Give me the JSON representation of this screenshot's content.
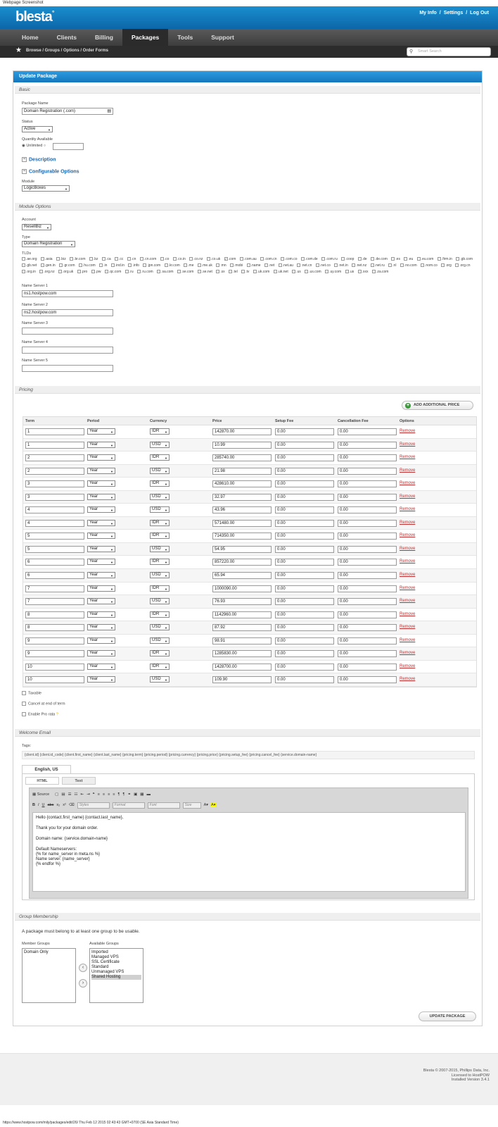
{
  "caption": "Webpage Screenshot",
  "brand": "blesta",
  "toplinks": {
    "my_info": "My Info",
    "sep1": "/",
    "settings": "Settings",
    "sep2": "/",
    "logout": "Log Out"
  },
  "nav": [
    "Home",
    "Clients",
    "Billing",
    "Packages",
    "Tools",
    "Support"
  ],
  "breadcrumb": "Browse / Groups / Options / Order Forms",
  "search_placeholder": "Smart Search",
  "panel_title": "Update Package",
  "sections": {
    "basic": "Basic",
    "module_options": "Module Options",
    "pricing": "Pricing",
    "welcome": "Welcome Email",
    "group": "Group Membership"
  },
  "basic": {
    "package_name_label": "Package Name",
    "package_name": "Domain Registration (.com)",
    "status_label": "Status",
    "status": "Active",
    "qty_label": "Quantity Available",
    "unlimited": "Unlimited",
    "description": "Description",
    "configurable": "Configurable Options",
    "module_label": "Module",
    "module": "LogicBoxes"
  },
  "module": {
    "account_label": "Account",
    "account": "ResellBiz",
    "type_label": "Type",
    "type": "Domain Registration",
    "tlds_label": "TLDs",
    "tlds": [
      ".ae.org",
      ".asia",
      ".biz",
      ".br.com",
      ".bz",
      ".ca",
      ".cc",
      ".cn",
      ".cn.com",
      ".co",
      ".co.in",
      ".co.nz",
      ".co.uk",
      ".com",
      ".com.au",
      ".com.cn",
      ".com.co",
      ".com.de",
      ".com.ru",
      ".coop",
      ".de",
      ".de.com",
      ".es",
      ".eu",
      ".eu.com",
      ".firm.in",
      ".gb.com",
      ".gb.net",
      ".gen.in",
      ".gr.com",
      ".hu.com",
      ".in",
      ".ind.in",
      ".info",
      ".jpn.com",
      ".kr.com",
      ".me",
      ".me.uk",
      ".mn",
      ".mobi",
      ".name",
      ".net",
      ".net.au",
      ".net.cn",
      ".net.co",
      ".net.in",
      ".net.nz",
      ".net.ru",
      ".nl",
      ".no.com",
      ".nom.co",
      ".org",
      ".org.cn",
      ".org.in",
      ".org.nz",
      ".org.uk",
      ".pro",
      ".pw",
      ".qc.com",
      ".ru",
      ".ru.com",
      ".sa.com",
      ".se.com",
      ".se.net",
      ".sx",
      ".tel",
      ".tv",
      ".uk.com",
      ".uk.net",
      ".us",
      ".us.com",
      ".uy.com",
      ".us",
      ".xxx",
      ".za.com"
    ],
    "ns_labels": [
      "Name Server 1",
      "Name Server 2",
      "Name Server 3",
      "Name Server 4",
      "Name Server 5"
    ],
    "ns_values": [
      "ns1.hostpow.com",
      "ns2.hostpow.com",
      "",
      "",
      ""
    ]
  },
  "pricing": {
    "add_button": "ADD ADDITIONAL PRICE",
    "headers": [
      "Term",
      "Period",
      "Currency",
      "Price",
      "Setup Fee",
      "Cancellation Fee",
      "Options"
    ],
    "remove": "Remove",
    "rows": [
      {
        "term": "1",
        "period": "Year",
        "currency": "IDR",
        "price": "142870.00",
        "setup": "0.00",
        "cancel": "0.00"
      },
      {
        "term": "1",
        "period": "Year",
        "currency": "USD",
        "price": "10.99",
        "setup": "0.00",
        "cancel": "0.00"
      },
      {
        "term": "2",
        "period": "Year",
        "currency": "IDR",
        "price": "285740.00",
        "setup": "0.00",
        "cancel": "0.00"
      },
      {
        "term": "2",
        "period": "Year",
        "currency": "USD",
        "price": "21.98",
        "setup": "0.00",
        "cancel": "0.00"
      },
      {
        "term": "3",
        "period": "Year",
        "currency": "IDR",
        "price": "428610.00",
        "setup": "0.00",
        "cancel": "0.00"
      },
      {
        "term": "3",
        "period": "Year",
        "currency": "USD",
        "price": "32.97",
        "setup": "0.00",
        "cancel": "0.00"
      },
      {
        "term": "4",
        "period": "Year",
        "currency": "USD",
        "price": "43.96",
        "setup": "0.00",
        "cancel": "0.00"
      },
      {
        "term": "4",
        "period": "Year",
        "currency": "IDR",
        "price": "571480.00",
        "setup": "0.00",
        "cancel": "0.00"
      },
      {
        "term": "5",
        "period": "Year",
        "currency": "IDR",
        "price": "714350.00",
        "setup": "0.00",
        "cancel": "0.00"
      },
      {
        "term": "5",
        "period": "Year",
        "currency": "USD",
        "price": "54.95",
        "setup": "0.00",
        "cancel": "0.00"
      },
      {
        "term": "6",
        "period": "Year",
        "currency": "IDR",
        "price": "857220.00",
        "setup": "0.00",
        "cancel": "0.00"
      },
      {
        "term": "6",
        "period": "Year",
        "currency": "USD",
        "price": "65.94",
        "setup": "0.00",
        "cancel": "0.00"
      },
      {
        "term": "7",
        "period": "Year",
        "currency": "IDR",
        "price": "1000090.00",
        "setup": "0.00",
        "cancel": "0.00"
      },
      {
        "term": "7",
        "period": "Year",
        "currency": "USD",
        "price": "76.93",
        "setup": "0.00",
        "cancel": "0.00"
      },
      {
        "term": "8",
        "period": "Year",
        "currency": "IDR",
        "price": "1142960.00",
        "setup": "0.00",
        "cancel": "0.00"
      },
      {
        "term": "8",
        "period": "Year",
        "currency": "USD",
        "price": "87.92",
        "setup": "0.00",
        "cancel": "0.00"
      },
      {
        "term": "9",
        "period": "Year",
        "currency": "USD",
        "price": "98.91",
        "setup": "0.00",
        "cancel": "0.00"
      },
      {
        "term": "9",
        "period": "Year",
        "currency": "IDR",
        "price": "1285830.00",
        "setup": "0.00",
        "cancel": "0.00"
      },
      {
        "term": "10",
        "period": "Year",
        "currency": "IDR",
        "price": "1428700.00",
        "setup": "0.00",
        "cancel": "0.00"
      },
      {
        "term": "10",
        "period": "Year",
        "currency": "USD",
        "price": "109.90",
        "setup": "0.00",
        "cancel": "0.00"
      }
    ],
    "taxable": "Taxable",
    "cancel_end": "Cancel at end of term",
    "prorata": "Enable Pro rata"
  },
  "welcome": {
    "tags_label": "Tags:",
    "tags": "{client.id} {client.id_code} {client.first_name} {client.last_name} {pricing.term} {pricing.period} {pricing.currency} {pricing.price} {pricing.setup_fee} {pricing.cancel_fee} {service.domain-name}",
    "lang_tab": "English, US",
    "tab_html": "HTML",
    "tab_text": "Text",
    "source": "Source",
    "styles": "Styles",
    "format": "Format",
    "font": "Font",
    "size": "Size",
    "body": [
      "Hello {contact.first_name} {contact.last_name},",
      "Thank you for your domain order.",
      "Domain name: {service.domain-name}",
      "Default Nameservers:",
      "{% for name_server in meta.ns %}",
      "Name server: {name_server}",
      "{% endfor %}"
    ]
  },
  "group": {
    "note": "A package must belong to at least one group to be usable.",
    "member_label": "Member Groups",
    "available_label": "Available Groups",
    "members": [
      "Domain Only"
    ],
    "available": [
      "Imported",
      "Managed VPS",
      "SSL Certificate",
      "Standard",
      "Unmanaged VPS",
      "Shared Hosting"
    ]
  },
  "update_button": "UPDATE PACKAGE",
  "copyright": [
    "Blesta © 2007-2015, Phillips Data, Inc.",
    "Licensed to HostPOW",
    "Installed Version 3.4.1"
  ],
  "status_bar": "https://www.hostpow.com/mily/packages/edit/26/ Thu Feb 12 2015 02:43:43 GMT+0700 (SE Asia Standard Time)"
}
